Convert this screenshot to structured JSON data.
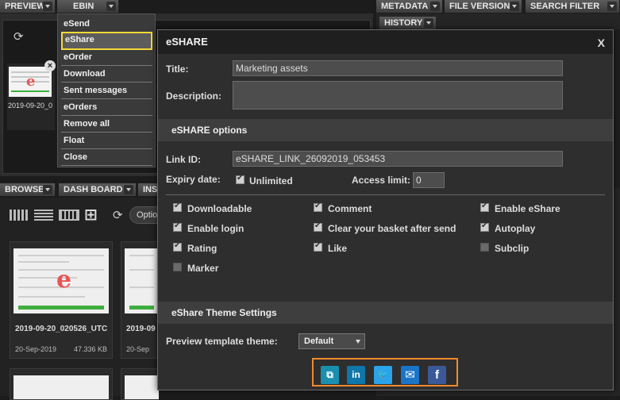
{
  "top_tabs": {
    "preview": "PREVIEW",
    "ebin": "EBIN",
    "metadata": "METADATA",
    "file_version": "FILE VERSION",
    "search_filter": "SEARCH FILTER",
    "history": "HISTORY"
  },
  "preview": {
    "thumb_label": "2019-09-20_0"
  },
  "ebin_menu": {
    "items": [
      "eSend",
      "eShare",
      "eOrder",
      "Download",
      "Sent messages",
      "eOrders",
      "Remove all",
      "Float",
      "Close"
    ],
    "active": "eShare"
  },
  "browse": {
    "tabs": {
      "browse": "BROWSE",
      "dashboard": "DASH BOARD",
      "ins": "INS"
    },
    "options_label": "Optio",
    "cards": [
      {
        "name": "2019-09-20_020526_UTC",
        "date": "20-Sep-2019",
        "size": "47.336 KB"
      },
      {
        "name": "2019-09",
        "date": "20-Sep",
        "size": ""
      }
    ]
  },
  "dialog": {
    "title": "eSHARE",
    "close": "X",
    "title_label": "Title:",
    "title_value": "Marketing assets",
    "description_label": "Description:",
    "description_value": "",
    "options_header": "eSHARE options",
    "link_id_label": "Link ID:",
    "link_id_value": "eSHARE_LINK_26092019_053453",
    "expiry_label": "Expiry date:",
    "unlimited_label": "Unlimited",
    "access_limit_label": "Access limit:",
    "access_limit_value": "0",
    "options": {
      "downloadable": {
        "label": "Downloadable",
        "checked": true
      },
      "enable_login": {
        "label": "Enable login",
        "checked": true
      },
      "rating": {
        "label": "Rating",
        "checked": true
      },
      "marker": {
        "label": "Marker",
        "checked": false
      },
      "comment": {
        "label": "Comment",
        "checked": true
      },
      "clear_basket": {
        "label": "Clear your basket after send",
        "checked": true
      },
      "like": {
        "label": "Like",
        "checked": true
      },
      "enable_eshare": {
        "label": "Enable eShare",
        "checked": true
      },
      "autoplay": {
        "label": "Autoplay",
        "checked": true
      },
      "subclip": {
        "label": "Subclip",
        "checked": false
      }
    },
    "theme_header": "eShare Theme Settings",
    "theme_label": "Preview template theme:",
    "theme_value": "Default",
    "share_buttons": [
      {
        "name": "copy-link",
        "icon": "copy-icon",
        "glyph": "⧉",
        "color": "#1a8fb0"
      },
      {
        "name": "linkedin",
        "icon": "linkedin-icon",
        "glyph": "in",
        "color": "#0e76a8"
      },
      {
        "name": "twitter",
        "icon": "twitter-icon",
        "glyph": "🐦",
        "color": "#2aa3e8"
      },
      {
        "name": "email",
        "icon": "email-icon",
        "glyph": "✉",
        "color": "#1a75c8"
      },
      {
        "name": "facebook",
        "icon": "facebook-icon",
        "glyph": "f",
        "color": "#3b5998"
      }
    ]
  }
}
